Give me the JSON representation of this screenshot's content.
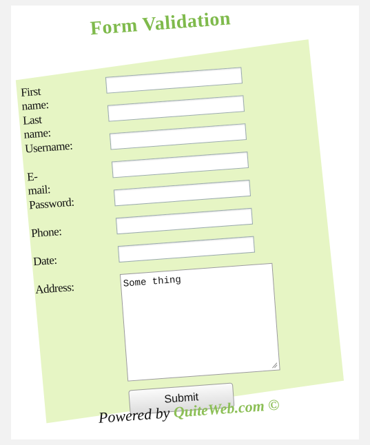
{
  "title": "Form Validation",
  "fields": {
    "first_name": {
      "label": "First name:",
      "value": ""
    },
    "last_name": {
      "label": "Last name:",
      "value": ""
    },
    "username": {
      "label": "Username:",
      "value": ""
    },
    "email": {
      "label": "E-mail:",
      "value": ""
    },
    "password": {
      "label": "Password:",
      "value": ""
    },
    "phone": {
      "label": "Phone:",
      "value": ""
    },
    "date": {
      "label": "Date:",
      "value": ""
    },
    "address": {
      "label": "Address:",
      "value": "Some thing"
    }
  },
  "submit_label": "Submit",
  "footer": {
    "prefix": "Powered by ",
    "brand": "QuiteWeb.com",
    "suffix": " ©"
  },
  "colors": {
    "form_bg": "#e6f5c4",
    "accent": "#7fba4c"
  }
}
